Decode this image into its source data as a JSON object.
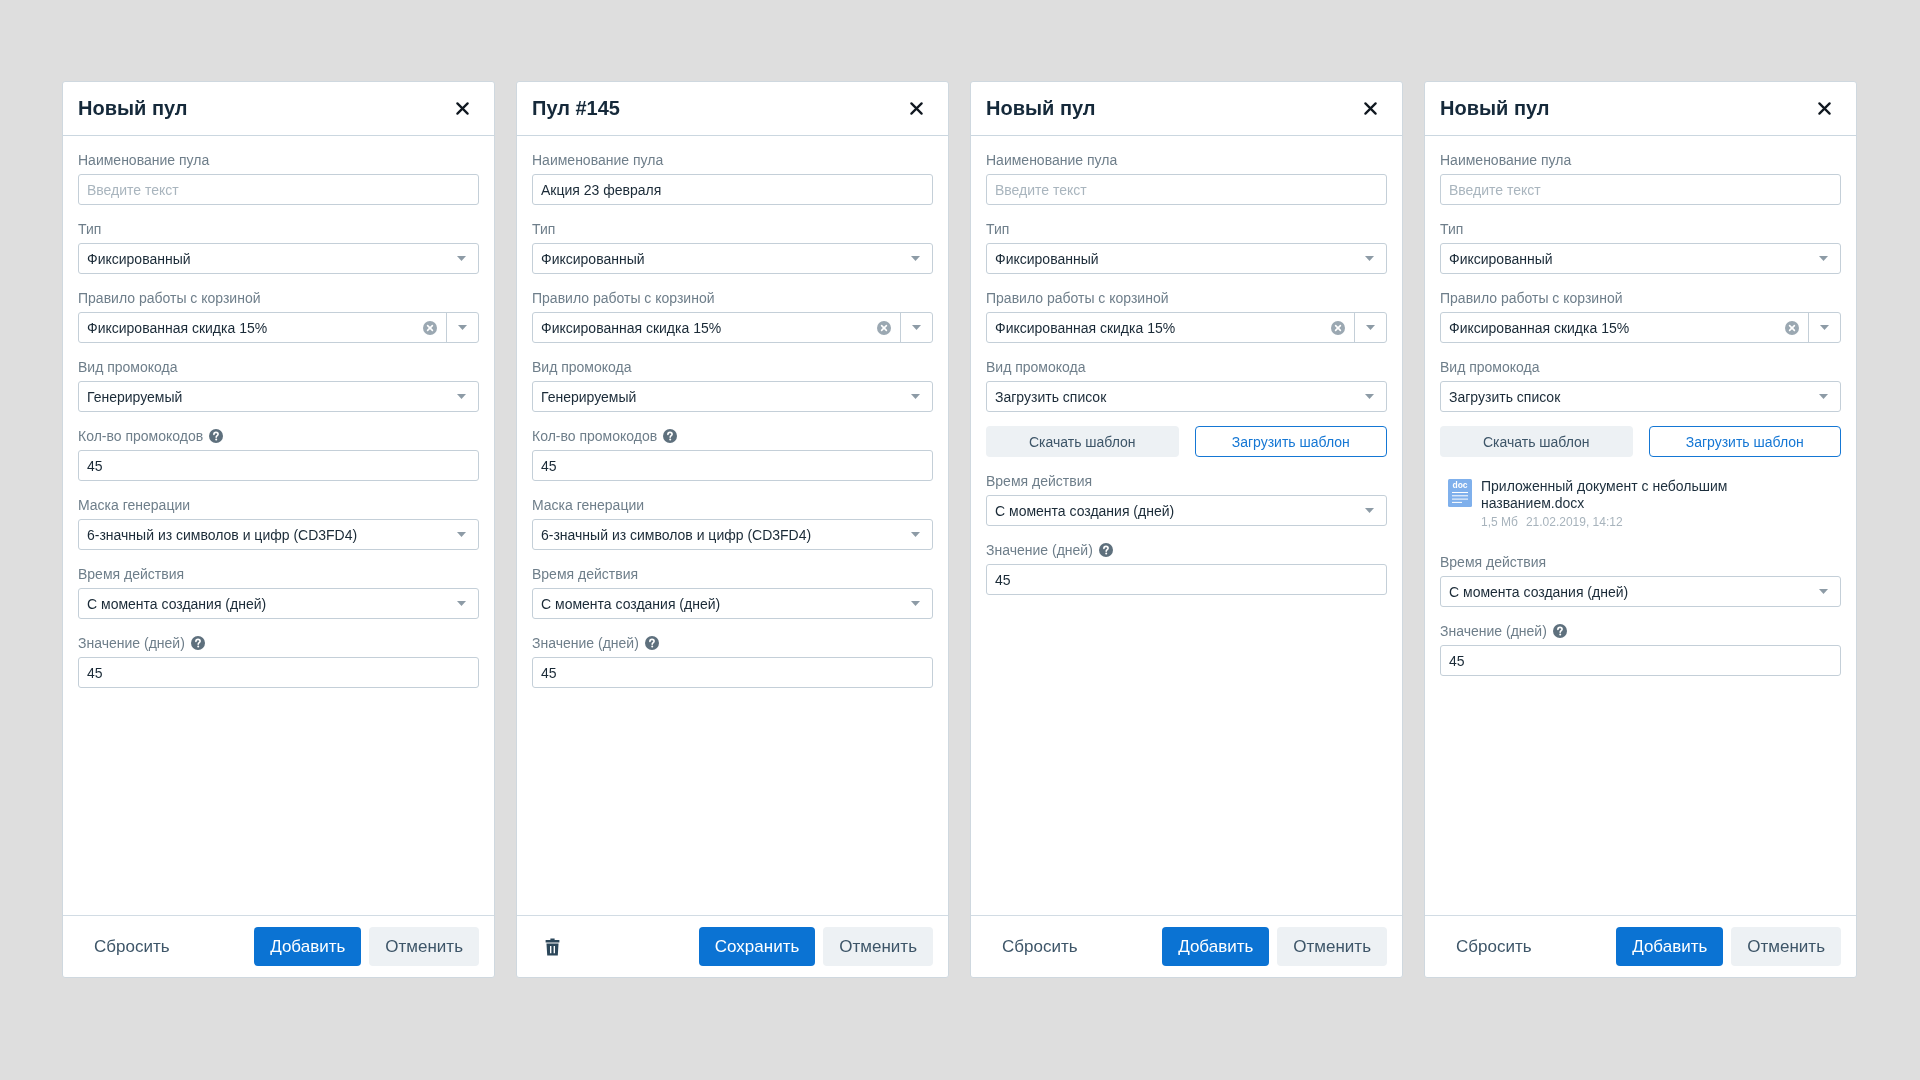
{
  "dialogs": [
    {
      "title": "Новый пул",
      "fields": [
        {
          "kind": "text",
          "label": "Наименование пула",
          "placeholder": "Введите текст"
        },
        {
          "kind": "select",
          "label": "Тип",
          "value": "Фиксированный"
        },
        {
          "kind": "clearable_select",
          "label": "Правило работы с корзиной",
          "value": "Фиксированная скидка 15%"
        },
        {
          "kind": "select",
          "label": "Вид промокода",
          "value": "Генерируемый"
        },
        {
          "kind": "text",
          "label": "Кол-во промокодов",
          "help": true,
          "value": "45"
        },
        {
          "kind": "select",
          "label": "Маска генерации",
          "value": "6-значный из символов и цифр (CD3FD4)"
        },
        {
          "kind": "select",
          "label": "Время действия",
          "value": "С момента создания (дней)"
        },
        {
          "kind": "text",
          "label": "Значение (дней)",
          "help": true,
          "value": "45"
        }
      ],
      "footer": {
        "left": {
          "kind": "reset",
          "label": "Сбросить"
        },
        "submit": "Добавить",
        "cancel": "Отменить"
      }
    },
    {
      "title": "Пул #145",
      "fields": [
        {
          "kind": "text",
          "label": "Наименование пула",
          "value": "Акция 23 февраля"
        },
        {
          "kind": "select",
          "label": "Тип",
          "value": "Фиксированный"
        },
        {
          "kind": "clearable_select",
          "label": "Правило работы с корзиной",
          "value": "Фиксированная скидка 15%"
        },
        {
          "kind": "select",
          "label": "Вид промокода",
          "value": "Генерируемый"
        },
        {
          "kind": "text",
          "label": "Кол-во промокодов",
          "help": true,
          "value": "45"
        },
        {
          "kind": "select",
          "label": "Маска генерации",
          "value": "6-значный из символов и цифр (CD3FD4)"
        },
        {
          "kind": "select",
          "label": "Время действия",
          "value": "С момента создания (дней)"
        },
        {
          "kind": "text",
          "label": "Значение (дней)",
          "help": true,
          "value": "45"
        }
      ],
      "footer": {
        "left": {
          "kind": "delete"
        },
        "submit": "Сохранить",
        "cancel": "Отменить"
      }
    },
    {
      "title": "Новый пул",
      "fields": [
        {
          "kind": "text",
          "label": "Наименование пула",
          "placeholder": "Введите текст"
        },
        {
          "kind": "select",
          "label": "Тип",
          "value": "Фиксированный"
        },
        {
          "kind": "clearable_select",
          "label": "Правило работы с корзиной",
          "value": "Фиксированная скидка 15%"
        },
        {
          "kind": "select",
          "label": "Вид промокода",
          "value": "Загрузить список"
        },
        {
          "kind": "template_buttons",
          "buttons": [
            {
              "kind": "download",
              "label": "Скачать шаблон"
            },
            {
              "kind": "upload",
              "label": "Загрузить шаблон"
            }
          ]
        },
        {
          "kind": "select",
          "label": "Время действия",
          "value": "С момента создания (дней)"
        },
        {
          "kind": "text",
          "label": "Значение (дней)",
          "help": true,
          "value": "45"
        }
      ],
      "footer": {
        "left": {
          "kind": "reset",
          "label": "Сбросить"
        },
        "submit": "Добавить",
        "cancel": "Отменить"
      }
    },
    {
      "title": "Новый пул",
      "fields": [
        {
          "kind": "text",
          "label": "Наименование пула",
          "placeholder": "Введите текст"
        },
        {
          "kind": "select",
          "label": "Тип",
          "value": "Фиксированный"
        },
        {
          "kind": "clearable_select",
          "label": "Правило работы с корзиной",
          "value": "Фиксированная скидка 15%"
        },
        {
          "kind": "select",
          "label": "Вид промокода",
          "value": "Загрузить список"
        },
        {
          "kind": "template_buttons",
          "buttons": [
            {
              "kind": "download",
              "label": "Скачать шаблон"
            },
            {
              "kind": "upload",
              "label": "Загрузить шаблон"
            }
          ]
        },
        {
          "kind": "file",
          "icon_label": "doc",
          "name": "Приложенный документ с небольшим названием.docx",
          "size": "1,5 Мб",
          "date": "21.02.2019, 14:12"
        },
        {
          "kind": "select",
          "label": "Время действия",
          "value": "С момента создания (дней)"
        },
        {
          "kind": "text",
          "label": "Значение (дней)",
          "help": true,
          "value": "45"
        }
      ],
      "footer": {
        "left": {
          "kind": "reset",
          "label": "Сбросить"
        },
        "submit": "Добавить",
        "cancel": "Отменить"
      }
    }
  ]
}
